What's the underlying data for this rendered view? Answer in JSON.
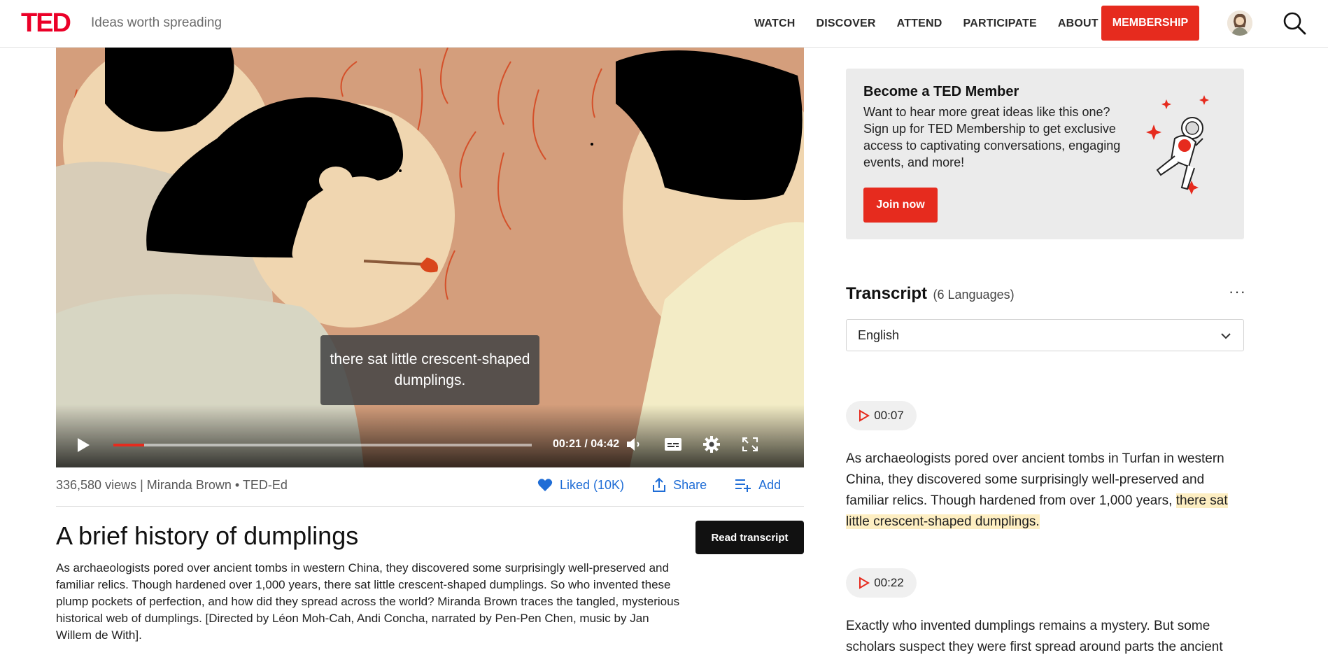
{
  "header": {
    "logo": "TED",
    "tagline": "Ideas worth spreading",
    "nav": [
      "WATCH",
      "DISCOVER",
      "ATTEND",
      "PARTICIPATE",
      "ABOUT"
    ],
    "membership": "MEMBERSHIP"
  },
  "video": {
    "caption": "there sat little crescent-shaped dumplings.",
    "timecode": "00:21 / 04:42",
    "progress": 0.074
  },
  "meta": {
    "views": "336,580 views",
    "speaker": "Miranda Brown",
    "channel": "TED-Ed",
    "liked": "Liked (10K)",
    "share": "Share",
    "add": "Add"
  },
  "talk": {
    "title": "A brief history of dumplings",
    "read_transcript": "Read transcript",
    "description": "As archaeologists pored over ancient tombs in western China, they discovered some surprisingly well-preserved and familiar relics. Though hardened over 1,000 years, there sat little crescent-shaped dumplings. So who invented these plump pockets of perfection, and how did they spread across the world? Miranda Brown traces the tangled, mysterious historical web of dumplings. [Directed by Léon Moh-Cah, Andi Concha, narrated by Pen-Pen Chen, music by Jan Willem de With]."
  },
  "membership_card": {
    "title": "Become a TED Member",
    "text": "Want to hear more great ideas like this one? Sign up for TED Membership to get exclusive access to captivating conversations, engaging events, and more!",
    "button": "Join now"
  },
  "transcript": {
    "title": "Transcript",
    "languages": "(6 Languages)",
    "selected_language": "English",
    "segments": [
      {
        "time": "00:07",
        "text_before": "As archaeologists pored over ancient tombs in Turfan in western China, they discovered some surprisingly well-preserved and familiar relics. Though hardened from over 1,000 years, ",
        "highlight": "there sat little crescent-shaped dumplings."
      },
      {
        "time": "00:22",
        "text": "Exactly who invented dumplings remains a mystery. But some scholars suspect they were first spread around parts the ancient"
      }
    ]
  },
  "colors": {
    "ted_red": "#e62b1e",
    "link_blue": "#1f6dd6",
    "highlight": "#fdeec2"
  }
}
